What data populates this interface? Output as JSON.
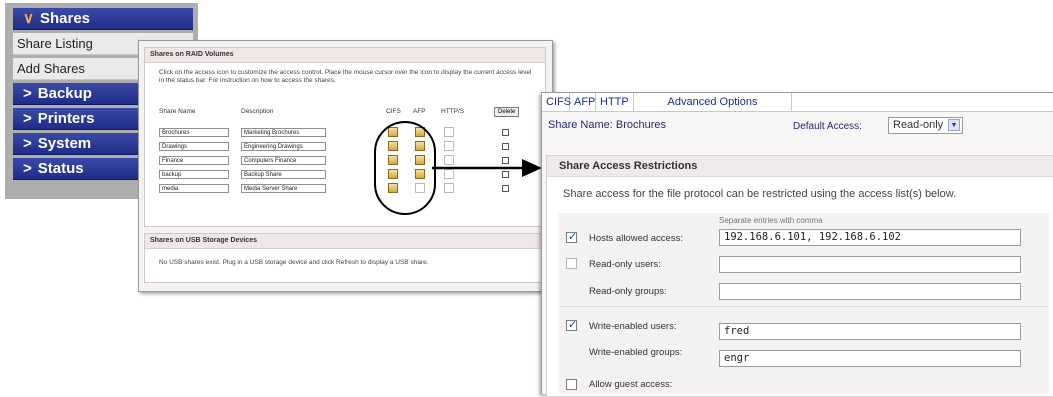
{
  "nav": {
    "items": [
      {
        "label": "Shares",
        "style": "blue",
        "icon": "chevron-down-icon",
        "glyph": "∨"
      },
      {
        "label": "Share Listing",
        "style": "gray"
      },
      {
        "label": "Add Shares",
        "style": "gray"
      },
      {
        "label": "Backup",
        "style": "blue",
        "icon": "chevron-right-icon",
        "glyph": ">"
      },
      {
        "label": "Printers",
        "style": "blue",
        "icon": "chevron-right-icon",
        "glyph": ">"
      },
      {
        "label": "System",
        "style": "blue",
        "icon": "chevron-right-icon",
        "glyph": ">"
      },
      {
        "label": "Status",
        "style": "blue",
        "icon": "chevron-right-icon",
        "glyph": ">"
      }
    ]
  },
  "raid": {
    "title": "Shares on RAID Volumes",
    "instructions": "Click on the access icon to customize the access control. Place the mouse cursor over the icon to display the current access level in the status bar. For instruction on how to access the shares,",
    "columns": [
      "Share Name",
      "Description",
      "CIFS",
      "AFP",
      "HTTP/S"
    ],
    "delete_label": "Delete",
    "rows": [
      {
        "name": "Brochures",
        "description": "Marketing Brochures"
      },
      {
        "name": "Drawings",
        "description": "Engineering Drawings"
      },
      {
        "name": "Finance",
        "description": "Computers Finance"
      },
      {
        "name": "backup",
        "description": "Backup Share"
      },
      {
        "name": "media",
        "description": "Media Server Share"
      }
    ]
  },
  "usb": {
    "title": "Shares on USB Storage Devices",
    "message": "No USB shares exist. Plug in a USB storage device and click Refresh to display a USB share."
  },
  "detail": {
    "tabs": [
      "CIFS",
      "AFP",
      "HTTP",
      "Advanced Options"
    ],
    "share_name_label": "Share Name:",
    "share_name": "Brochures",
    "default_access_label": "Default Access:",
    "default_access": "Read-only",
    "section_title": "Share Access Restrictions",
    "section_desc": "Share access for the file protocol can be restricted using the access list(s) below.",
    "hint": "Separate entries with comma",
    "fields": {
      "hosts_label": "Hosts allowed access:",
      "hosts_value": "192.168.6.101, 192.168.6.102",
      "ro_users_label": "Read-only users:",
      "ro_users_value": "",
      "ro_groups_label": "Read-only groups:",
      "ro_groups_value": "",
      "rw_users_label": "Write-enabled users:",
      "rw_users_value": "fred",
      "rw_groups_label": "Write-enabled groups:",
      "rw_groups_value": "engr",
      "guest_label": "Allow guest access:"
    }
  },
  "colors": {
    "nav_blue": "#2a3897",
    "arrow": "#000000"
  }
}
